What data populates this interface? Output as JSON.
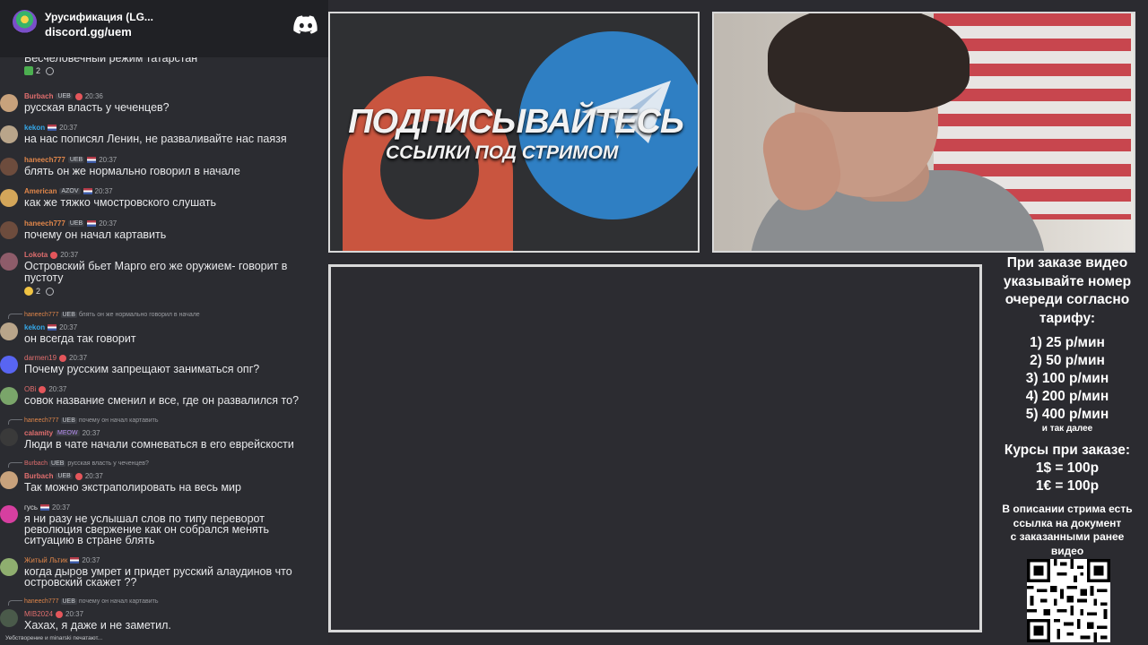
{
  "server": {
    "name": "Урусификация (LG...",
    "link": "discord.gg/uem"
  },
  "chat": {
    "messages": [
      {
        "id": "m0",
        "text": "Бесчеловечный режим татарстан",
        "reactions": {
          "count": "2"
        }
      },
      {
        "id": "m1",
        "user": "Burbach",
        "tag": "UEB",
        "time": "20:36",
        "text": "русская власть у чеченцев?",
        "user_color": "#e06e6e"
      },
      {
        "id": "m2",
        "user": "kekon",
        "time": "20:37",
        "text": "на нас пописял Ленин, не разваливайте нас паязя",
        "user_color": "#35a7e8"
      },
      {
        "id": "m3",
        "user": "haneech777",
        "tag": "UEB",
        "time": "20:37",
        "text": "блять он же нормально говорил в начале",
        "user_color": "#e0864a"
      },
      {
        "id": "m4",
        "user": "American",
        "tag": "AZOV",
        "time": "20:37",
        "text": "как же тяжко чмостровского слушать",
        "user_color": "#e0864a"
      },
      {
        "id": "m5",
        "user": "haneech777",
        "tag": "UEB",
        "time": "20:37",
        "text": "почему он начал картавить",
        "user_color": "#e0864a"
      },
      {
        "id": "m6",
        "user": "Lokota",
        "time": "20:37",
        "text": "Островский бьет Марго его же оружием- говорит в",
        "text2": "пустоту",
        "reactions": {
          "count": "2"
        },
        "user_color": "#e06e6e"
      },
      {
        "id": "m7",
        "reply": {
          "user": "haneech777",
          "tag": "UEB",
          "text": "блять он же нормально говорил в начале"
        },
        "user": "kekon",
        "time": "20:37",
        "text": "он всегда так говорит",
        "user_color": "#35a7e8"
      },
      {
        "id": "m8",
        "user": "darmen19",
        "time": "20:37",
        "text": "Почему русским запрещают заниматься опг?",
        "user_color": "#e06e6e"
      },
      {
        "id": "m9",
        "user": "OBi",
        "time": "20:37",
        "text": "совок название сменил и все, где он развалился то?",
        "user_color": "#e06e6e"
      },
      {
        "id": "m10",
        "reply": {
          "user": "haneech777",
          "tag": "UEB",
          "text": "почему он начал картавить"
        },
        "user": "calamity",
        "tag": "MEOW",
        "time": "20:37",
        "text": "Люди в чате начали сомневаться в его еврейскости",
        "user_color": "#e06e6e"
      },
      {
        "id": "m11",
        "reply": {
          "user": "Burbach",
          "tag": "UEB",
          "text": "русская власть у чеченцев?"
        },
        "user": "Burbach",
        "tag": "UEB",
        "time": "20:37",
        "text": "Так можно экстраполировать на весь мир",
        "user_color": "#e06e6e"
      },
      {
        "id": "m12",
        "user": "гусь",
        "time": "20:37",
        "text": "я ни разу не услышал слов по типу переворот",
        "text2": "революция свержение как он собрался менять",
        "text3": "ситуацию в стране блять",
        "user_color": "#dcddde"
      },
      {
        "id": "m13",
        "user": "Житый Льтик",
        "time": "20:37",
        "text": "когда дыров умрет и придет русский алаудинов что",
        "text2": "островский скажет ??",
        "user_color": "#e0864a"
      },
      {
        "id": "m14",
        "reply": {
          "user": "haneech777",
          "tag": "UEB",
          "text": "почему он начал картавить"
        },
        "user": "MIB2024",
        "time": "20:37",
        "text": "Хахах, я даже и не заметил.",
        "user_color": "#e06e6e"
      }
    ],
    "typing": "Уебстворение и minarski печатают..."
  },
  "promo": {
    "title": "ПОДПИСЫВАЙТЕСЬ",
    "subtitle": "ССЫЛКИ ПОД СТРИМОМ"
  },
  "pricing": {
    "header": [
      "При заказе видео",
      "указывайте номер",
      "очереди согласно",
      "тарифу:"
    ],
    "tiers": [
      "1) 25 р/мин",
      "2) 50 р/мин",
      "3) 100 р/мин",
      "4) 200 р/мин",
      "5) 400 р/мин"
    ],
    "etc": "и так далее",
    "rates_title": "Курсы при заказе:",
    "rates": [
      "1$ = 100р",
      "1€ = 100р"
    ],
    "note": [
      "В описании стрима есть",
      "ссылка на документ",
      "с заказанными ранее",
      "видео"
    ]
  },
  "colors": {
    "discord_blurple": "#5865f2",
    "chat_bg": "#2b2c31",
    "telegram_blue": "#2f7fc3",
    "patreon_red": "#c9553f"
  }
}
